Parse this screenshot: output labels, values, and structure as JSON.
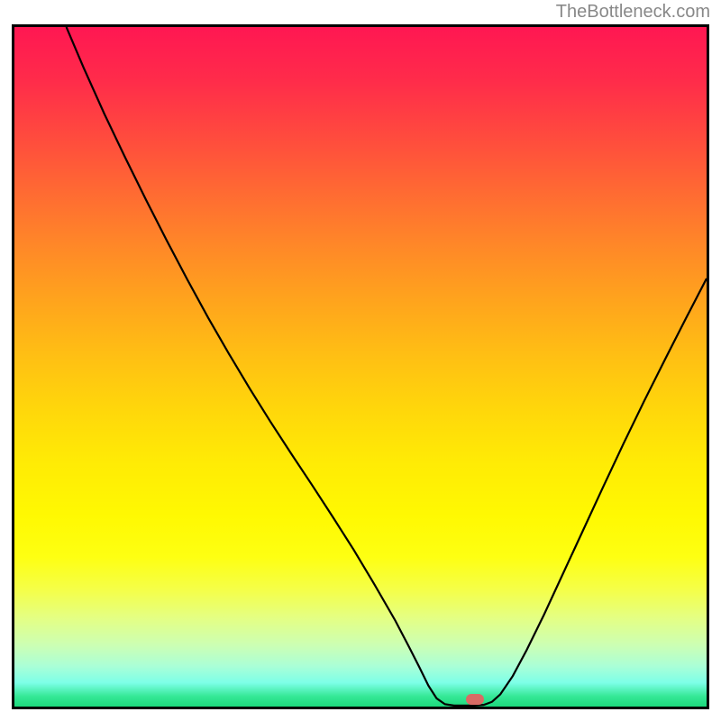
{
  "watermark_text": "TheBottleneck.com",
  "chart_data": {
    "type": "line",
    "title": "",
    "xlabel": "",
    "ylabel": "",
    "xlim": [
      0,
      100
    ],
    "ylim": [
      0,
      100
    ],
    "grid": false,
    "curve_points_pct": [
      [
        7.5,
        100.0
      ],
      [
        10.0,
        94.0
      ],
      [
        13.0,
        87.2
      ],
      [
        16.0,
        80.8
      ],
      [
        19.0,
        74.6
      ],
      [
        22.0,
        68.6
      ],
      [
        25.0,
        62.8
      ],
      [
        28.0,
        57.2
      ],
      [
        31.0,
        51.9
      ],
      [
        34.0,
        46.8
      ],
      [
        37.0,
        41.9
      ],
      [
        40.0,
        37.2
      ],
      [
        43.0,
        32.6
      ],
      [
        46.0,
        27.9
      ],
      [
        49.0,
        23.1
      ],
      [
        52.0,
        18.0
      ],
      [
        55.0,
        12.7
      ],
      [
        57.0,
        8.8
      ],
      [
        58.5,
        5.8
      ],
      [
        59.8,
        3.1
      ],
      [
        61.0,
        1.2
      ],
      [
        62.2,
        0.35
      ],
      [
        63.5,
        0.15
      ],
      [
        65.0,
        0.15
      ],
      [
        66.5,
        0.15
      ],
      [
        67.8,
        0.25
      ],
      [
        69.0,
        0.7
      ],
      [
        70.2,
        1.8
      ],
      [
        72.0,
        4.5
      ],
      [
        74.0,
        8.3
      ],
      [
        76.5,
        13.5
      ],
      [
        79.0,
        19.0
      ],
      [
        82.0,
        25.6
      ],
      [
        85.0,
        32.2
      ],
      [
        88.0,
        38.7
      ],
      [
        91.0,
        45.0
      ],
      [
        94.0,
        51.1
      ],
      [
        97.0,
        57.1
      ],
      [
        100.0,
        63.0
      ]
    ],
    "marker_position_pct": [
      66.5,
      1.0
    ],
    "marker_color": "#d96b65",
    "gradient_stops": [
      {
        "pos": 0,
        "color": "#ff1752"
      },
      {
        "pos": 50,
        "color": "#ffd60b"
      },
      {
        "pos": 80,
        "color": "#feff12"
      },
      {
        "pos": 100,
        "color": "#1cd97c"
      }
    ]
  }
}
